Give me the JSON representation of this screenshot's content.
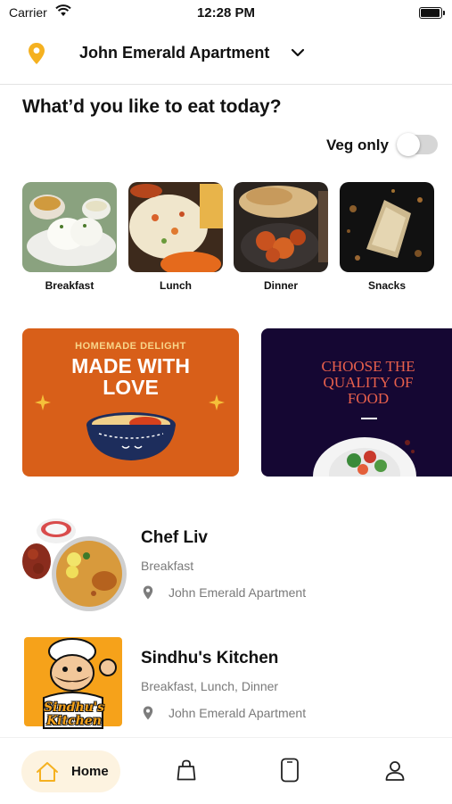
{
  "status_bar": {
    "carrier": "Carrier",
    "time": "12:28 PM"
  },
  "header": {
    "location_name": "John Emerald Apartment",
    "accent_color": "#f5b120"
  },
  "main": {
    "heading": "What’d you like to eat today?",
    "veg_filter": {
      "label": "Veg only",
      "enabled": false
    },
    "categories": [
      {
        "label": "Breakfast"
      },
      {
        "label": "Lunch"
      },
      {
        "label": "Dinner"
      },
      {
        "label": "Snacks"
      }
    ],
    "banners": [
      {
        "kicker": "HOMEMADE DELIGHT",
        "headline_line1": "MADE WITH",
        "headline_line2": "LOVE"
      },
      {
        "line1": "CHOOSE THE",
        "line2": "QUALITY OF",
        "line3": "FOOD"
      }
    ],
    "restaurants": [
      {
        "name": "Chef Liv",
        "meals": "Breakfast",
        "address": "John Emerald Apartment"
      },
      {
        "name": "Sindhu's Kitchen",
        "meals": "Breakfast, Lunch, Dinner",
        "address": "John Emerald Apartment",
        "logo_text": "Sindhu's Kitchen"
      }
    ]
  },
  "tab_bar": {
    "items": [
      {
        "label": "Home",
        "icon": "home-icon",
        "active": true
      },
      {
        "icon": "bag-icon"
      },
      {
        "icon": "phone-icon"
      },
      {
        "icon": "profile-icon"
      }
    ]
  }
}
